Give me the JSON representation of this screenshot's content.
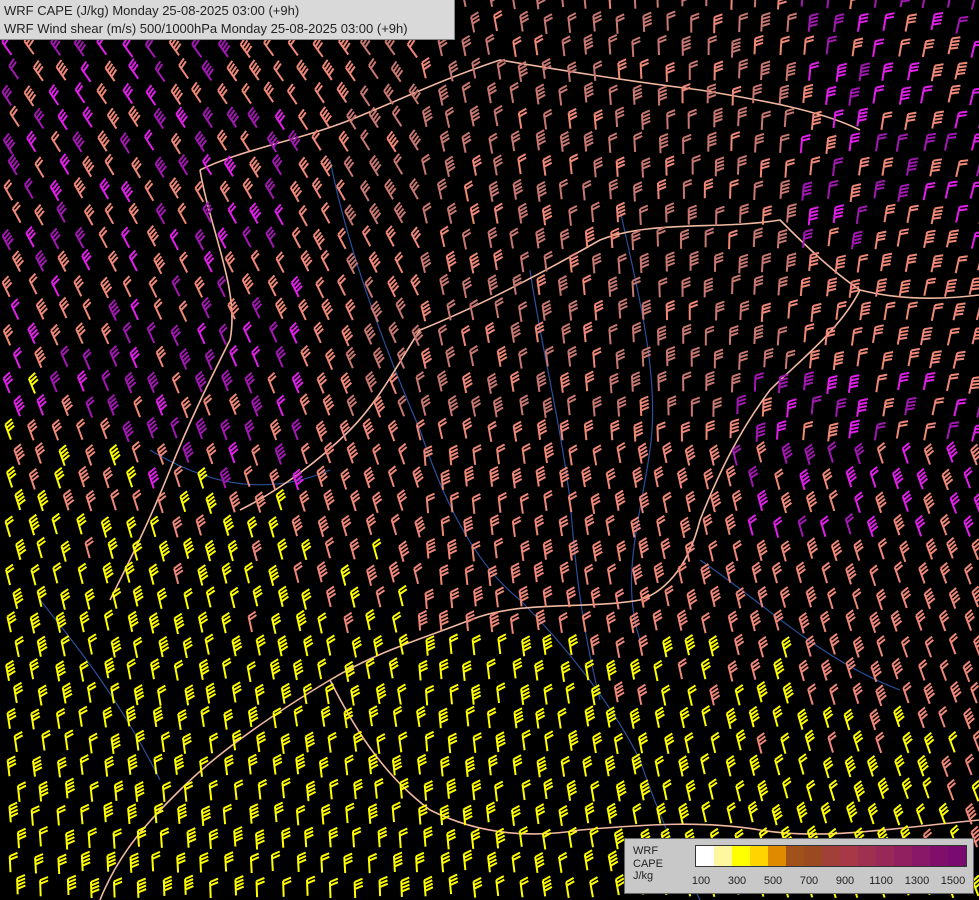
{
  "header": {
    "line1": "WRF CAPE (J/kg) Monday 25-08-2025 03:00 (+9h)",
    "line2": "WRF Wind shear (m/s) 500/1000hPa Monday 25-08-2025 03:00 (+9h)"
  },
  "legend": {
    "title_lines": [
      "WRF",
      "CAPE",
      "J/kg"
    ],
    "colors": [
      "#ffffff",
      "#fff7a0",
      "#ffff00",
      "#ffd400",
      "#e08a00",
      "#a0521a",
      "#9a4a20",
      "#a04038",
      "#a83848",
      "#a03050",
      "#982858",
      "#902060",
      "#8a1868",
      "#800f6c",
      "#780a70"
    ],
    "tick_labels": [
      "100",
      "300",
      "500",
      "700",
      "900",
      "1100",
      "1300",
      "1500"
    ]
  },
  "map": {
    "barb_colors": {
      "yellow": "#ffff00",
      "salmon": "#f08878",
      "rose": "#c87870",
      "magenta": "#e020e8",
      "dark_purple": "#a018b0"
    },
    "border_color": "#f0b8a0",
    "river_color": "#2a4f9a"
  }
}
